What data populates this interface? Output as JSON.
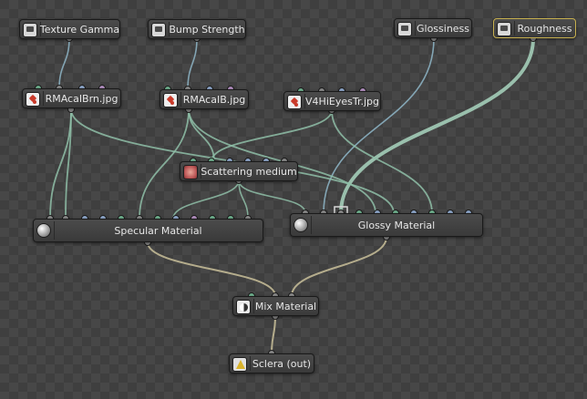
{
  "nodes": [
    {
      "id": "texture-gamma",
      "label": "Texture Gamma",
      "icon": "value-icon"
    },
    {
      "id": "bump-strength",
      "label": "Bump Strength",
      "icon": "value-icon"
    },
    {
      "id": "glossiness",
      "label": "Glossiness",
      "icon": "value-icon"
    },
    {
      "id": "roughness",
      "label": "Roughness",
      "icon": "value-icon",
      "selected": true
    },
    {
      "id": "rmacaibrn",
      "label": "RMAcaIBrn.jpg",
      "icon": "image-texture-icon"
    },
    {
      "id": "rmacaib",
      "label": "RMAcaIB.jpg",
      "icon": "image-texture-icon"
    },
    {
      "id": "v4hieyestr",
      "label": "V4HiEyesTr.jpg",
      "icon": "image-texture-icon"
    },
    {
      "id": "scattering-medium",
      "label": "Scattering medium",
      "icon": "scattering-icon"
    },
    {
      "id": "specular-material",
      "label": "Specular Material",
      "icon": "material-sphere-icon"
    },
    {
      "id": "glossy-material",
      "label": "Glossy Material",
      "icon": "material-sphere-icon"
    },
    {
      "id": "mix-material",
      "label": "Mix Material",
      "icon": "mix-icon"
    },
    {
      "id": "sclera-out",
      "label": "Sclera (out)",
      "icon": "output-icon"
    }
  ],
  "colors": {
    "canvas_dark": "#3f3f3f",
    "canvas_light": "#474747",
    "wire_texture": "#8fc0a8",
    "wire_material": "#c9c09a",
    "wire_value": "#8fb7c9",
    "selection": "#c7b04f",
    "pin_green": "#6fb08e",
    "pin_blue": "#8ea6c9",
    "pin_purple": "#b28fc0",
    "pin_gray": "#8a8a8a"
  }
}
